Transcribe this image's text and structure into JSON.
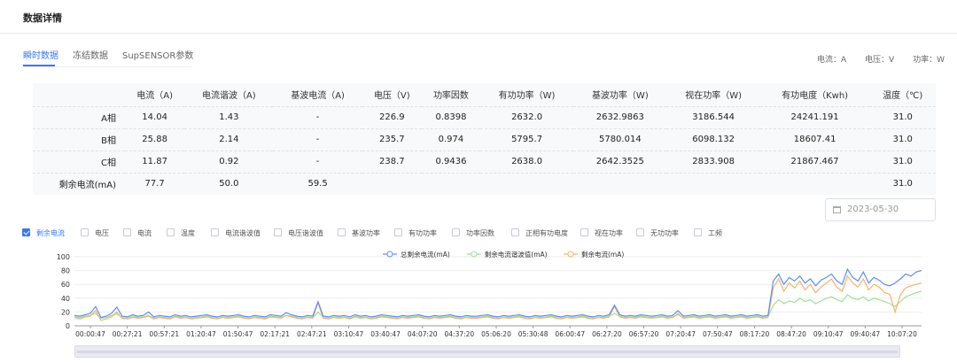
{
  "page": {
    "title": "数据详情"
  },
  "tabs": [
    {
      "label": "瞬时数据",
      "active": true
    },
    {
      "label": "冻结数据",
      "active": false
    },
    {
      "label": "SupSENSOR参数",
      "active": false
    }
  ],
  "units": {
    "current": "电流：A",
    "voltage": "电压：V",
    "power": "功率：W"
  },
  "table": {
    "headers": [
      "",
      "电流（A)",
      "电流谐波（A)",
      "基波电流（A)",
      "电压（V)",
      "功率因数",
      "有功功率（W)",
      "基波功率（W)",
      "视在功率（W)",
      "有功电度（Kwh)",
      "温度（℃)"
    ],
    "rows": [
      [
        "A相",
        "14.04",
        "1.43",
        "-",
        "226.9",
        "0.8398",
        "2632.0",
        "2632.9863",
        "3186.544",
        "24241.191",
        "31.0"
      ],
      [
        "B相",
        "25.88",
        "2.14",
        "-",
        "235.7",
        "0.974",
        "5795.7",
        "5780.014",
        "6098.132",
        "18607.41",
        "31.0"
      ],
      [
        "C相",
        "11.87",
        "0.92",
        "-",
        "238.7",
        "0.9436",
        "2638.0",
        "2642.3525",
        "2833.908",
        "21867.467",
        "31.0"
      ],
      [
        "剩余电流(mA)",
        "77.7",
        "50.0",
        "59.5",
        "",
        "",
        "",
        "",
        "",
        "",
        "31.0"
      ]
    ]
  },
  "date_picker": {
    "value": "2023-05-30"
  },
  "checkboxes": [
    {
      "label": "剩余电流",
      "checked": true
    },
    {
      "label": "电压",
      "checked": false
    },
    {
      "label": "电流",
      "checked": false
    },
    {
      "label": "温度",
      "checked": false
    },
    {
      "label": "电流谐波值",
      "checked": false
    },
    {
      "label": "电压谐波值",
      "checked": false
    },
    {
      "label": "基波功率",
      "checked": false
    },
    {
      "label": "有功功率",
      "checked": false
    },
    {
      "label": "功率因数",
      "checked": false
    },
    {
      "label": "正相有功电度",
      "checked": false
    },
    {
      "label": "视在功率",
      "checked": false
    },
    {
      "label": "无功功率",
      "checked": false
    },
    {
      "label": "工频",
      "checked": false
    }
  ],
  "colors": {
    "accent": "#3a78f2",
    "series1": "#5b8ff9",
    "series2": "#9be29b",
    "series3": "#f7b267"
  },
  "chart_data": {
    "type": "line",
    "ylim": [
      0,
      100
    ],
    "yticks": [
      0,
      20,
      40,
      60,
      80,
      100
    ],
    "xticks": [
      "00:00:47",
      "00:27:21",
      "00:57:21",
      "01:20:47",
      "01:50:47",
      "02:17:21",
      "02:47:21",
      "03:10:47",
      "03:40:47",
      "04:07:20",
      "04:37:20",
      "05:06:20",
      "05:30:48",
      "06:00:47",
      "06:27:20",
      "06:57:20",
      "07:20:47",
      "07:50:47",
      "08:17:20",
      "08:47:20",
      "09:10:47",
      "09:40:47",
      "10:07:20"
    ],
    "legend": [
      "总剩余电流(mA)",
      "剩余电流谐波值(mA)",
      "剩余电流(mA)"
    ],
    "series": [
      {
        "name": "总剩余电流(mA)",
        "values": [
          15,
          14,
          16,
          18,
          28,
          12,
          14,
          18,
          27,
          14,
          13,
          16,
          14,
          15,
          20,
          13,
          15,
          14,
          13,
          16,
          14,
          15,
          13,
          14,
          15,
          16,
          14,
          13,
          15,
          14,
          15,
          16,
          14,
          13,
          15,
          14,
          13,
          16,
          15,
          14,
          19,
          16,
          14,
          13,
          15,
          14,
          35,
          14,
          13,
          15,
          14,
          15,
          13,
          16,
          14,
          15,
          13,
          14,
          16,
          15,
          14,
          13,
          15,
          14,
          15,
          16,
          14,
          13,
          15,
          14,
          15,
          16,
          14,
          13,
          15,
          14,
          14,
          15,
          16,
          14,
          13,
          15,
          14,
          15,
          16,
          14,
          13,
          15,
          14,
          15,
          16,
          14,
          13,
          15,
          14,
          15,
          16,
          14,
          13,
          15,
          14,
          16,
          30,
          16,
          14,
          15,
          14,
          16,
          15,
          14,
          15,
          16,
          14,
          15,
          22,
          14,
          15,
          16,
          14,
          15,
          16,
          14,
          15,
          16,
          14,
          15,
          16,
          14,
          15,
          16,
          14,
          15,
          65,
          75,
          60,
          70,
          65,
          72,
          62,
          68,
          58,
          66,
          70,
          75,
          65,
          60,
          82,
          70,
          65,
          78,
          62,
          70,
          66,
          60,
          58,
          62,
          68,
          75,
          72,
          78,
          80
        ]
      },
      {
        "name": "剩余电流谐波值(mA)",
        "values": [
          13,
          12,
          14,
          15,
          18,
          11,
          12,
          15,
          17,
          12,
          11,
          14,
          12,
          13,
          15,
          11,
          13,
          12,
          11,
          14,
          12,
          13,
          11,
          12,
          13,
          14,
          12,
          11,
          13,
          12,
          13,
          14,
          12,
          11,
          13,
          12,
          11,
          14,
          13,
          12,
          15,
          14,
          12,
          11,
          13,
          12,
          20,
          12,
          11,
          13,
          12,
          13,
          11,
          14,
          12,
          13,
          11,
          12,
          14,
          13,
          12,
          11,
          13,
          12,
          13,
          14,
          12,
          11,
          13,
          12,
          13,
          14,
          12,
          11,
          13,
          12,
          12,
          13,
          14,
          12,
          11,
          13,
          12,
          13,
          14,
          12,
          11,
          13,
          12,
          13,
          14,
          12,
          11,
          13,
          12,
          13,
          14,
          12,
          11,
          13,
          12,
          14,
          18,
          14,
          12,
          13,
          12,
          14,
          13,
          12,
          13,
          14,
          12,
          13,
          16,
          12,
          13,
          14,
          12,
          13,
          14,
          12,
          13,
          14,
          12,
          13,
          14,
          12,
          13,
          14,
          12,
          13,
          30,
          38,
          32,
          36,
          34,
          40,
          35,
          38,
          32,
          36,
          40,
          42,
          38,
          35,
          45,
          40,
          38,
          42,
          36,
          40,
          38,
          35,
          32,
          28,
          35,
          42,
          45,
          48,
          50
        ]
      },
      {
        "name": "剩余电流(mA)",
        "values": [
          12,
          10,
          13,
          14,
          22,
          8,
          10,
          13,
          20,
          11,
          10,
          12,
          11,
          12,
          14,
          10,
          12,
          11,
          10,
          13,
          11,
          12,
          10,
          11,
          12,
          13,
          11,
          10,
          12,
          11,
          12,
          13,
          11,
          10,
          12,
          11,
          10,
          13,
          12,
          11,
          15,
          13,
          11,
          10,
          12,
          11,
          33,
          11,
          10,
          12,
          11,
          12,
          10,
          13,
          11,
          12,
          10,
          11,
          13,
          12,
          11,
          10,
          12,
          11,
          12,
          13,
          11,
          10,
          12,
          11,
          12,
          13,
          11,
          10,
          12,
          11,
          11,
          12,
          13,
          11,
          10,
          12,
          11,
          12,
          13,
          11,
          10,
          12,
          11,
          12,
          13,
          11,
          10,
          12,
          11,
          12,
          13,
          11,
          10,
          12,
          11,
          13,
          28,
          13,
          11,
          12,
          11,
          13,
          12,
          11,
          12,
          13,
          11,
          12,
          18,
          11,
          12,
          13,
          11,
          12,
          13,
          11,
          12,
          13,
          11,
          12,
          13,
          11,
          12,
          13,
          11,
          12,
          55,
          68,
          50,
          62,
          55,
          65,
          52,
          60,
          48,
          56,
          62,
          68,
          56,
          50,
          72,
          62,
          56,
          68,
          52,
          60,
          56,
          48,
          46,
          20,
          45,
          55,
          58,
          60,
          62
        ]
      }
    ]
  }
}
